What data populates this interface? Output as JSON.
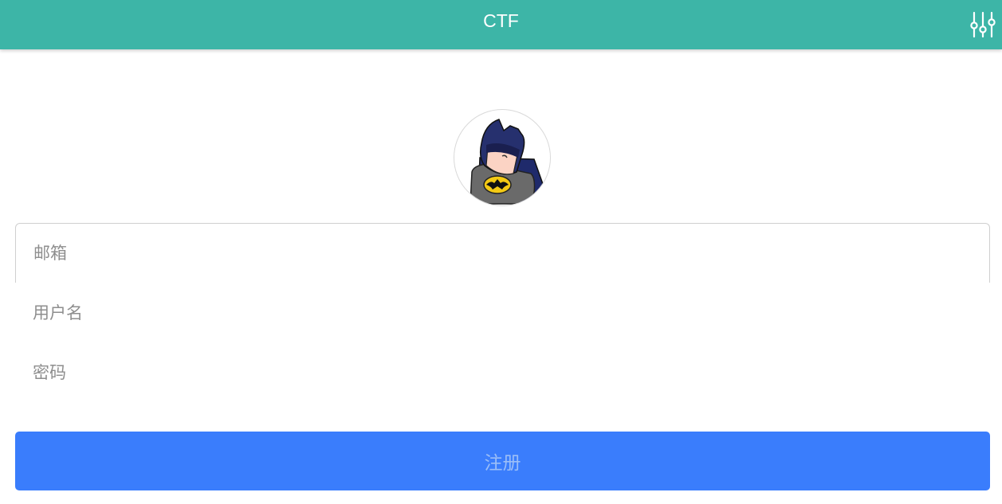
{
  "header": {
    "title": "CTF",
    "settings_icon": "sliders-icon",
    "background_color": "#3db5a7"
  },
  "avatar": {
    "icon": "batman-avatar-icon"
  },
  "form": {
    "email_placeholder": "邮箱",
    "email_value": "",
    "username_placeholder": "用户名",
    "username_value": "",
    "password_placeholder": "密码",
    "password_value": "",
    "submit_label": "注册",
    "submit_color": "#3a7dfc"
  }
}
